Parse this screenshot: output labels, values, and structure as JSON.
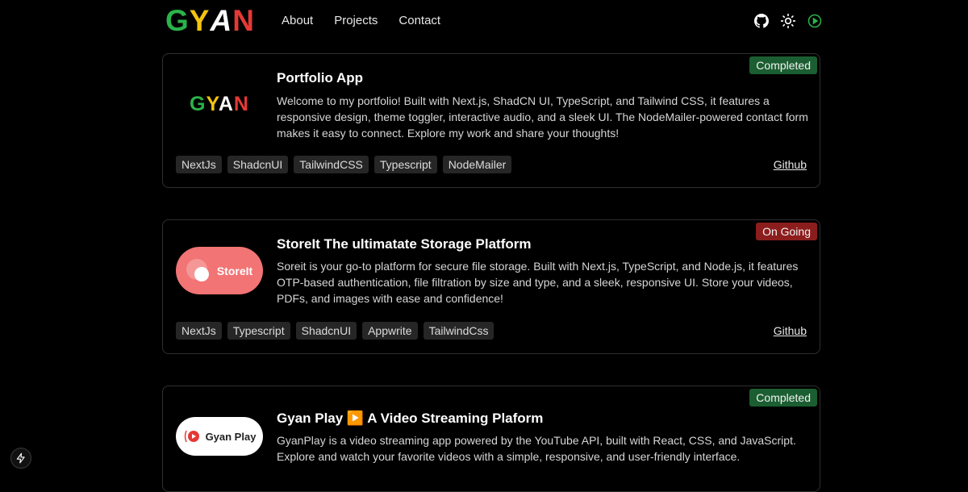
{
  "brand": {
    "letters": [
      "G",
      "Y",
      "A",
      "N"
    ],
    "colors": [
      "#2bb34a",
      "#f1c40f",
      "#ffffff",
      "#e53935"
    ]
  },
  "nav": {
    "links": [
      "About",
      "Projects",
      "Contact"
    ]
  },
  "icons": [
    "github-icon",
    "sun-icon",
    "play-circle-icon"
  ],
  "projects": [
    {
      "status": "Completed",
      "title": "Portfolio App",
      "thumb_text": "GYAN",
      "description": "Welcome to my portfolio! Built with Next.js, ShadCN UI, TypeScript, and Tailwind CSS, it features a responsive design, theme toggler, interactive audio, and a sleek UI. The NodeMailer-powered contact form makes it easy to connect. Explore my work and share your thoughts!",
      "tags": [
        "NextJs",
        "ShadcnUI",
        "TailwindCSS",
        "Typescript",
        "NodeMailer"
      ],
      "link": "Github"
    },
    {
      "status": "On Going",
      "title": "StoreIt The ultimatate Storage Platform",
      "thumb_text": "StoreIt",
      "description": "Soreit is your go-to platform for secure file storage. Built with Next.js, TypeScript, and Node.js, it features OTP-based authentication, file filtration by size and type, and a sleek, responsive UI. Store your videos, PDFs, and images with ease and confidence!",
      "tags": [
        "NextJs",
        "Typescript",
        "ShadcnUI",
        "Appwrite",
        "TailwindCss"
      ],
      "link": "Github"
    },
    {
      "status": "Completed",
      "title": "Gyan Play ▶️ A Video Streaming Plaform",
      "thumb_text": "Gyan Play",
      "description": "GyanPlay is a video streaming app powered by the YouTube API, built with React, CSS, and JavaScript. Explore and watch your favorite videos with a simple, responsive, and user-friendly interface."
    }
  ]
}
